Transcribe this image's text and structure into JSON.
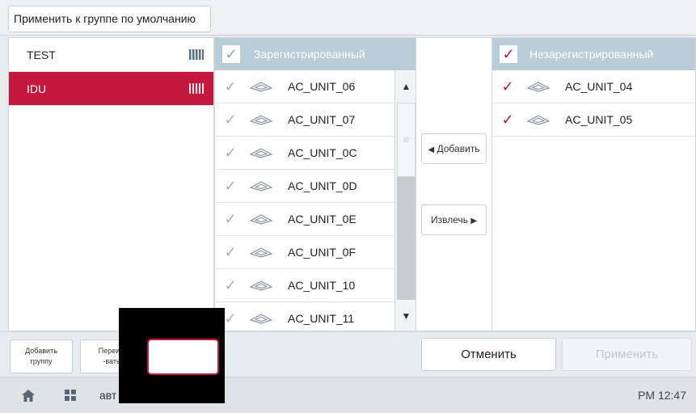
{
  "toolbar": {
    "apply_default_label": "Применить к группе по умолчанию"
  },
  "groups": [
    {
      "label": "TEST",
      "selected": false
    },
    {
      "label": "IDU",
      "selected": true
    }
  ],
  "registered": {
    "header": "Зарегистрированный",
    "items": [
      {
        "label": "AC_UNIT_06"
      },
      {
        "label": "AC_UNIT_07"
      },
      {
        "label": "AC_UNIT_0C"
      },
      {
        "label": "AC_UNIT_0D"
      },
      {
        "label": "AC_UNIT_0E"
      },
      {
        "label": "AC_UNIT_0F"
      },
      {
        "label": "AC_UNIT_10"
      },
      {
        "label": "AC_UNIT_11"
      }
    ]
  },
  "transfer": {
    "add_label": "Добавить",
    "remove_label": "Извлечь"
  },
  "unregistered": {
    "header": "Незарегистрированный",
    "items": [
      {
        "label": "AC_UNIT_04"
      },
      {
        "label": "AC_UNIT_05"
      }
    ]
  },
  "bottom": {
    "add_group_line1": "Добавить",
    "add_group_line2": "группу",
    "rename_line1": "Переим",
    "rename_line2": "-вать",
    "cancel_label": "Отменить",
    "apply_label": "Применить"
  },
  "status": {
    "text": "авт",
    "clock": "PM 12:47"
  },
  "icons": {
    "home": "home-icon",
    "grid": "grid-icon",
    "check": "check-icon",
    "unit": "ceiling-cassette-icon",
    "bars": "signal-bars-icon"
  },
  "colors": {
    "accent": "#c3173d",
    "header": "#b8cdd8",
    "check_inactive": "#a9b0b6"
  }
}
